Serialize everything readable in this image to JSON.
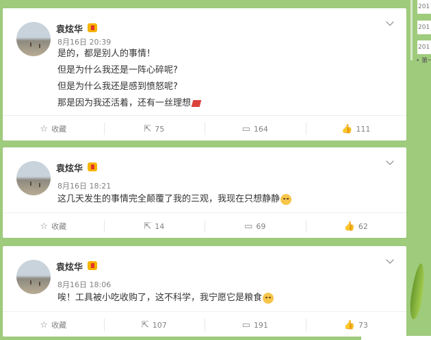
{
  "sidebar": {
    "years": [
      "201",
      "201",
      "201"
    ],
    "first_label": "第一"
  },
  "posts": [
    {
      "author": "袁炫华",
      "time": "8月16日 20:39",
      "lines": [
        "是的，都是别人的事情！",
        "但是为什么我还是一阵心碎呢?",
        "但是为什么我还是感到愤怒呢?",
        "那是因为我还活着，还有一丝理想"
      ],
      "fav_label": "收藏",
      "reposts": "75",
      "comments": "164",
      "likes": "111"
    },
    {
      "author": "袁炫华",
      "time": "8月16日 18:21",
      "lines": [
        "这几天发生的事情完全颠覆了我的三观，我现在只想静静"
      ],
      "fav_label": "收藏",
      "reposts": "14",
      "comments": "69",
      "likes": "62"
    },
    {
      "author": "袁炫华",
      "time": "8月16日 18:06",
      "lines": [
        "唉！工具被小吃收购了，这不科学，我宁愿它是粮食"
      ],
      "fav_label": "收藏",
      "reposts": "107",
      "comments": "191",
      "likes": "73"
    }
  ],
  "icons": {
    "favorite": "star-icon",
    "repost": "repost-icon",
    "comment": "comment-icon",
    "like": "thumbs-up-icon",
    "menu": "chevron-down-icon"
  },
  "colors": {
    "background": "#9fcb7c",
    "card": "#ffffff",
    "text": "#333333",
    "meta": "#808080"
  }
}
